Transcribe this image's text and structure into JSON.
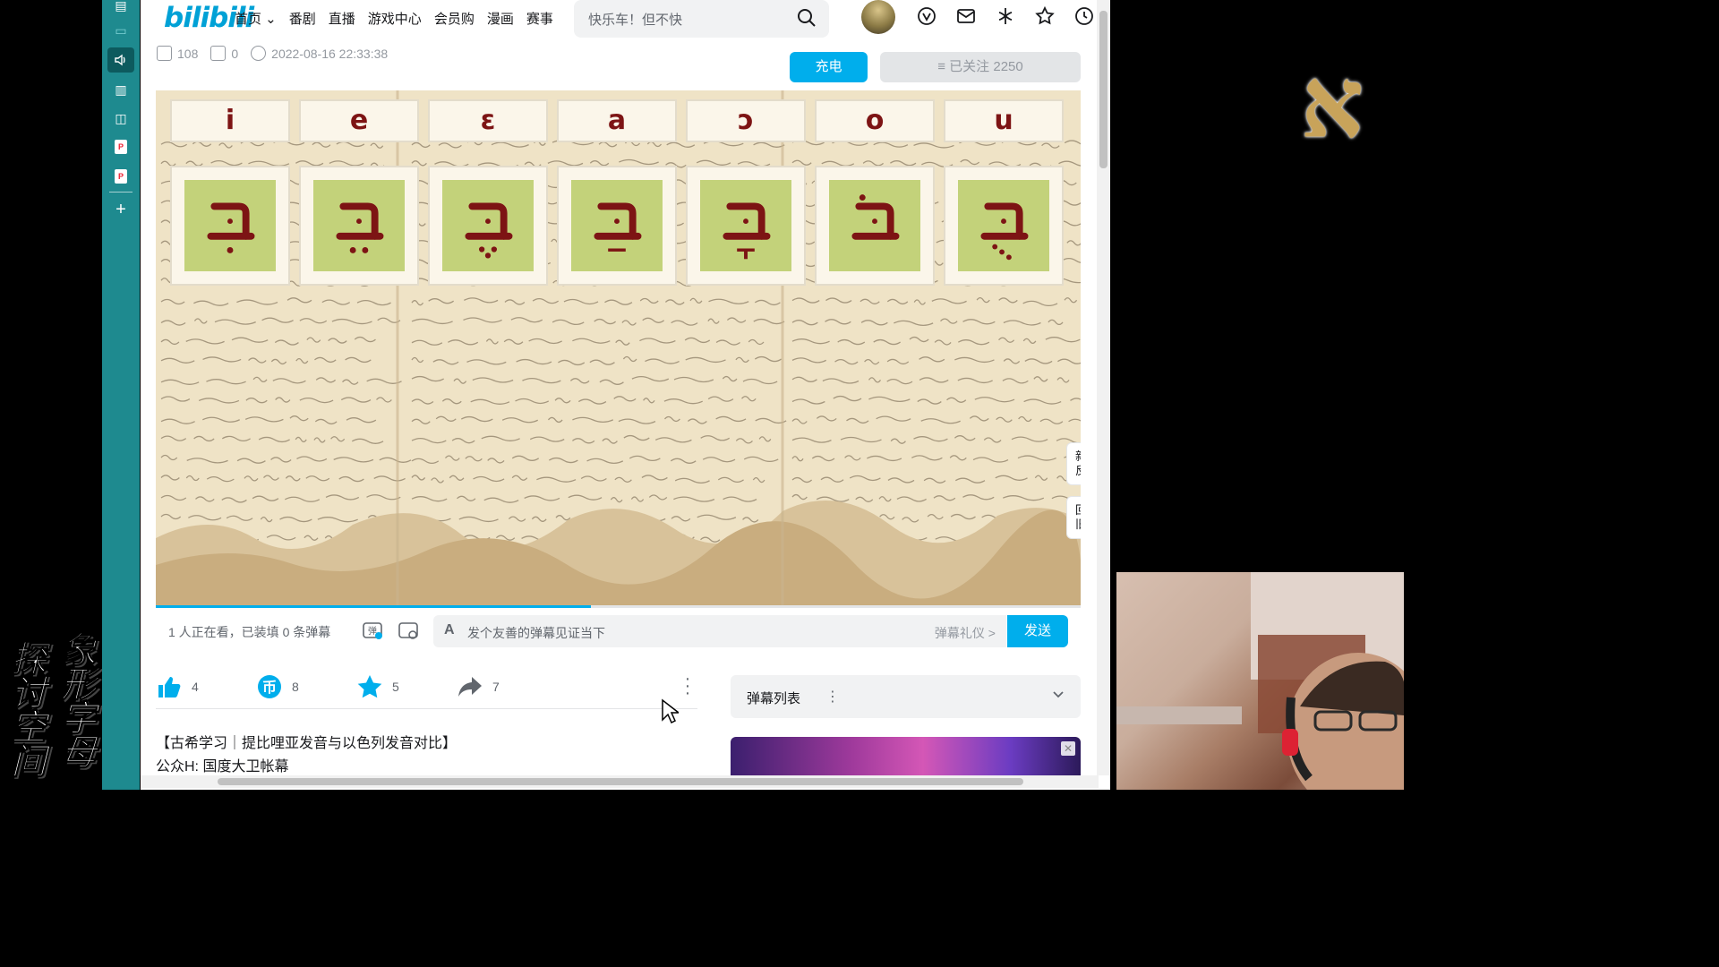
{
  "overlay": {
    "left_calligraphy_col1": "探讨空间",
    "left_calligraphy_col2": "象形字母",
    "aleph": "א"
  },
  "header": {
    "logo": "bilibili",
    "nav": [
      "首页",
      "番剧",
      "直播",
      "游戏中心",
      "会员购",
      "漫画",
      "赛事"
    ],
    "search_placeholder": "快乐车！但不快"
  },
  "video_meta": {
    "plays": "108",
    "danmaku_count": "0",
    "datetime": "2022-08-16 22:33:38"
  },
  "uploader": {
    "charge_label": "充电",
    "follow_label": "≡ 已关注 2250"
  },
  "video": {
    "vowels": [
      "i",
      "e",
      "ɛ",
      "a",
      "ɔ",
      "o",
      "u"
    ],
    "letters": [
      "בִ",
      "בֵ",
      "בֶ",
      "בַ",
      "בָ",
      "בֹ",
      "בֻ"
    ],
    "floating": {
      "feedback": "新版\n反馈",
      "old_version": "回到\n旧版"
    },
    "progress": 0.47
  },
  "danmaku_bar": {
    "status": "1 人正在看，已装填 0 条弹幕",
    "input_icon": "A",
    "placeholder": "发个友善的弹幕见证当下",
    "etiquette": "弹幕礼仪 >",
    "send": "发送"
  },
  "actions": {
    "like": "4",
    "coin": "8",
    "favorite": "5",
    "share": "7"
  },
  "description": {
    "title": "【古希学习｜提比哩亚发音与以色列发音对比】",
    "subtitle": "公众H:  国度大卫帐幕"
  },
  "danmaku_list": {
    "label": "弹幕列表"
  },
  "colors": {
    "accent": "#00aeec",
    "sidebar": "#1e8a8f",
    "letter": "#7d1414",
    "card_green": "#c3d27a"
  }
}
